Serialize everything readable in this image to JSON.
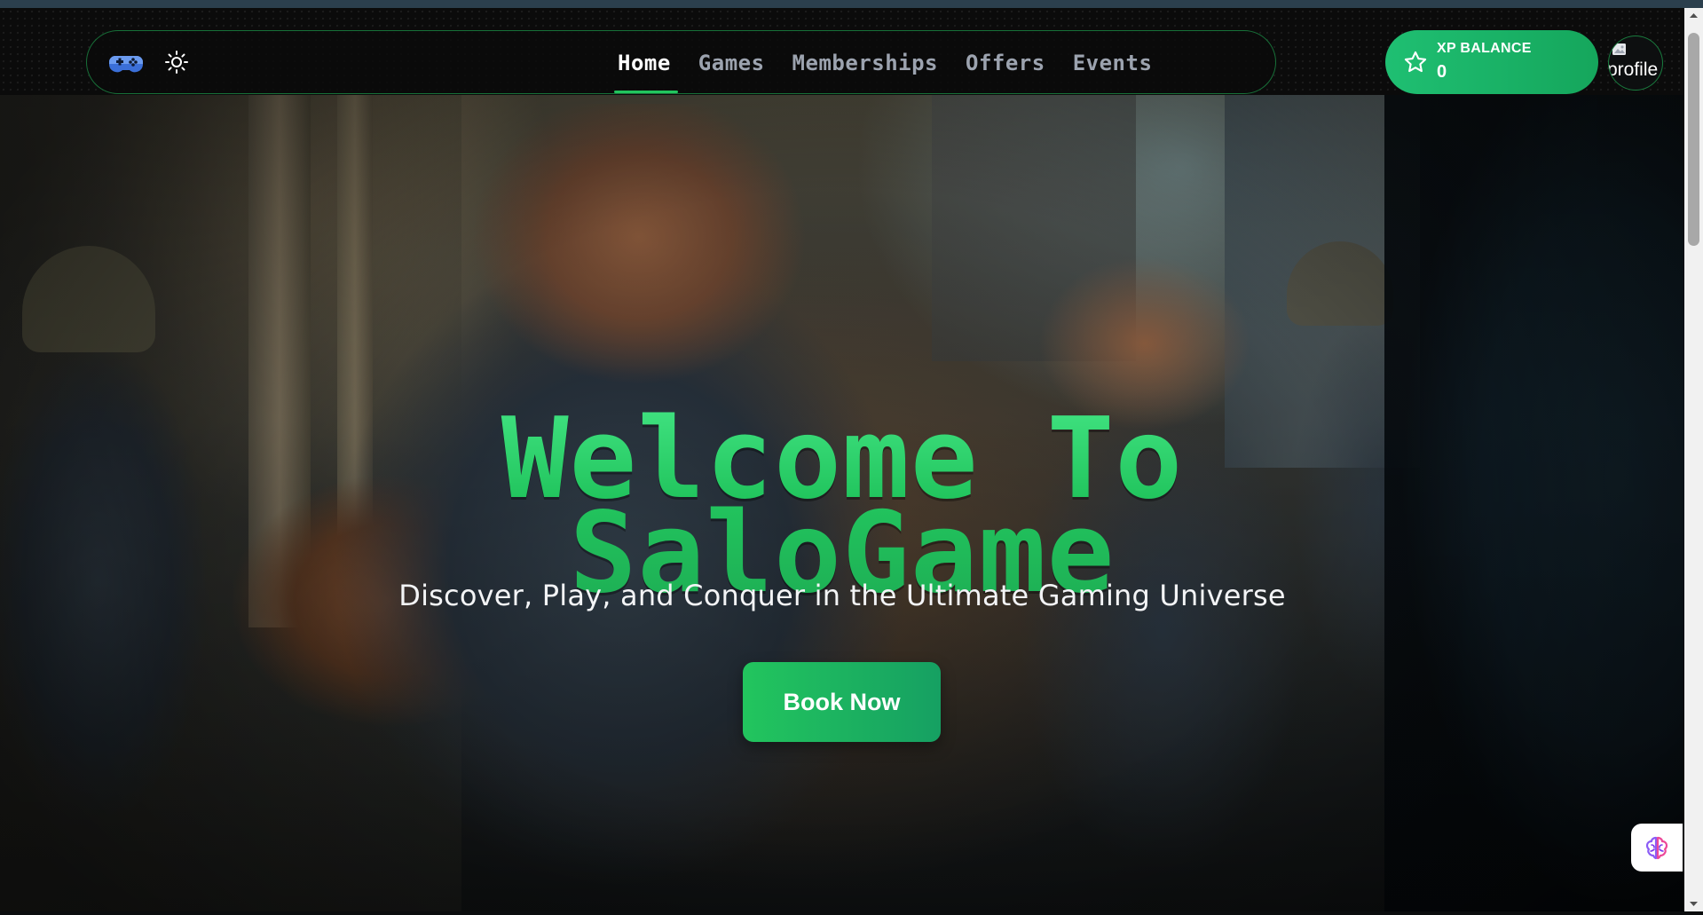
{
  "nav": {
    "logo_icon": "gamepad-icon",
    "theme_icon": "sun-icon",
    "links": [
      {
        "label": "Home",
        "active": true
      },
      {
        "label": "Games",
        "active": false
      },
      {
        "label": "Memberships",
        "active": false
      },
      {
        "label": "Offers",
        "active": false
      },
      {
        "label": "Events",
        "active": false
      }
    ]
  },
  "xp": {
    "label": "XP BALANCE",
    "value": "0",
    "icon": "star-icon"
  },
  "profile": {
    "alt_text": "profile"
  },
  "hero": {
    "title_line1": "Welcome To",
    "title_line2": "SaloGame",
    "subtitle": "Discover, Play, and Conquer in the Ultimate Gaming Universe",
    "cta_label": "Book Now"
  },
  "assistant": {
    "icon": "brain-icon"
  },
  "colors": {
    "accent": "#22c55e",
    "accent_dark": "#16a062",
    "nav_bg": "#0b0b0b",
    "nav_inactive": "#9ca3af"
  }
}
